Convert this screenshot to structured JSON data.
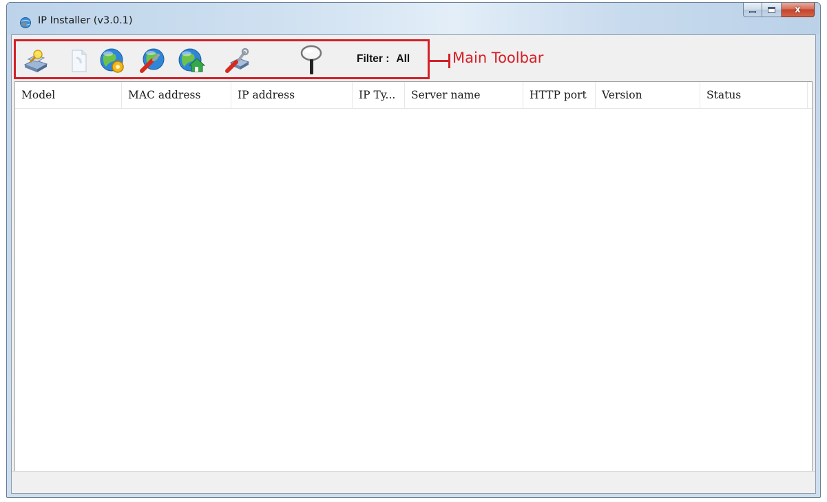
{
  "window": {
    "title": "IP Installer (v3.0.1)",
    "controls": {
      "minimize_icon": "minimize-icon",
      "maximize_icon": "maximize-icon",
      "close_glyph": "x"
    }
  },
  "toolbar": {
    "buttons": [
      {
        "icon": "search-devices-icon"
      },
      {
        "icon": "refresh-document-icon"
      },
      {
        "icon": "globe-settings-icon"
      },
      {
        "icon": "globe-tools-icon"
      },
      {
        "icon": "globe-home-icon"
      },
      {
        "icon": "tools-settings-icon"
      },
      {
        "icon": "magnifier-filter-icon"
      }
    ],
    "filter_label": "Filter :",
    "filter_value": "All"
  },
  "annotation": {
    "label": "Main Toolbar",
    "color": "#d42027"
  },
  "table": {
    "columns": [
      "Model",
      "MAC address",
      "IP address",
      "IP Ty...",
      "Server name",
      "HTTP port",
      "Version",
      "Status"
    ],
    "rows": []
  },
  "statusbar": {
    "text": ""
  }
}
